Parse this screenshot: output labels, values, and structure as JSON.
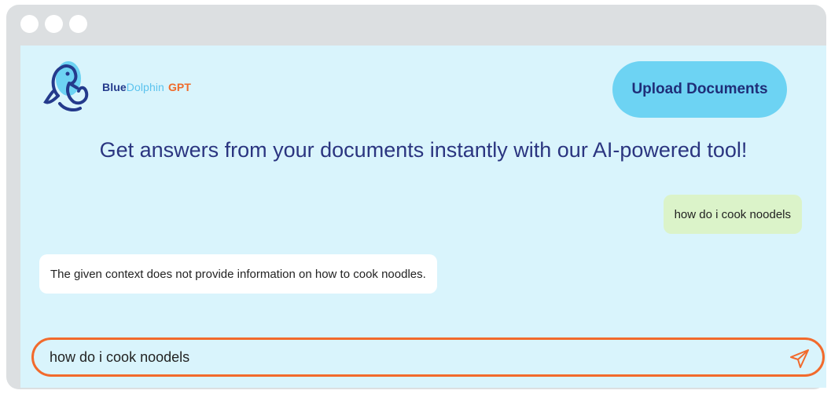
{
  "window": {
    "controls": [
      "dot",
      "dot",
      "dot"
    ]
  },
  "header": {
    "logo": {
      "blue": "Blue",
      "dolphin": "Dolphin",
      "gpt": "GPT"
    },
    "upload_button": "Upload Documents"
  },
  "headline": "Get answers from your documents instantly with our AI-powered tool!",
  "messages": [
    {
      "role": "user",
      "text": "how do i cook noodels"
    },
    {
      "role": "assistant",
      "text": "The given context does not provide information on how to cook noodles."
    }
  ],
  "input": {
    "value": "how do i cook noodels",
    "send_icon": "send-icon"
  },
  "colors": {
    "background": "#d9f4fc",
    "accent": "#6dd3f3",
    "input_border": "#f26a2c",
    "user_bubble": "#dbf3c9",
    "headline": "#2b3580"
  }
}
